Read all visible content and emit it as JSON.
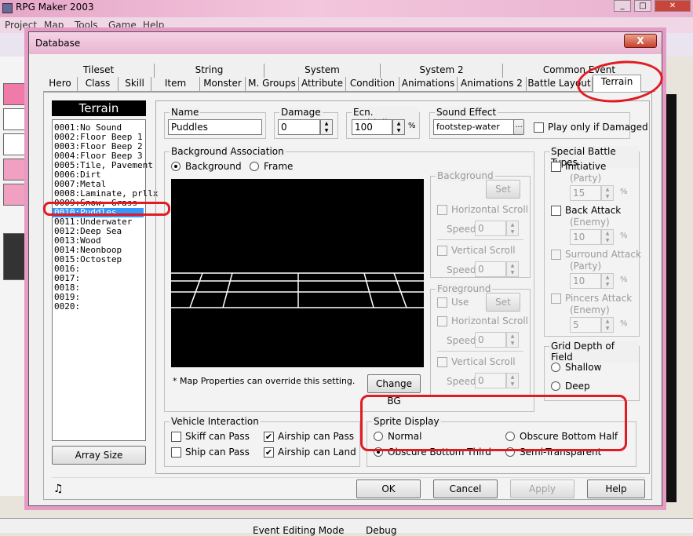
{
  "app": {
    "title": "RPG Maker 2003"
  },
  "menu": [
    "Project",
    "Map",
    "Tools",
    "Game",
    "Help"
  ],
  "dialog": {
    "title": "Database",
    "close": "X"
  },
  "tabs_row1": [
    "Tileset",
    "String",
    "System",
    "System 2",
    "Common Event"
  ],
  "tabs_row2": [
    "Hero",
    "Class",
    "Skill",
    "Item",
    "Monster",
    "M. Groups",
    "Attribute",
    "Condition",
    "Animations",
    "Animations 2",
    "Battle Layout",
    "Terrain"
  ],
  "list": {
    "header": "Terrain",
    "items": [
      "0001:No Sound",
      "0002:Floor Beep 1",
      "0003:Floor Beep 2",
      "0004:Floor Beep 3",
      "0005:Tile, Pavement",
      "0006:Dirt",
      "0007:Metal",
      "0008:Laminate, prllx",
      "0009:Snow, Grass",
      "0010:Puddles",
      "0011:Underwater",
      "0012:Deep Sea",
      "0013:Wood",
      "0014:Neonboop",
      "0015:Octostep",
      "0016:",
      "0017:",
      "0018:",
      "0019:",
      "0020:"
    ],
    "selected_index": 9,
    "array_size": "Array Size"
  },
  "name": {
    "label": "Name",
    "value": "Puddles"
  },
  "damage": {
    "label": "Damage",
    "value": "0"
  },
  "encounter": {
    "label": "Ecn. Multiplier",
    "value": "100",
    "unit": "%"
  },
  "sound": {
    "label": "Sound Effect",
    "value": "footstep-water",
    "browse": "...",
    "play_damaged": "Play only if Damaged"
  },
  "bg_assoc": {
    "label": "Background Association",
    "background": "Background",
    "frame": "Frame",
    "note": "* Map Properties can override this setting.",
    "change_bg": "Change BG",
    "bg_group": "Background",
    "fg_group": "Foreground",
    "set": "Set",
    "hscroll": "Horizontal Scroll",
    "vscroll": "Vertical Scroll",
    "speed": "Speed",
    "speed_val": "0",
    "use": "Use"
  },
  "special": {
    "label": "Special Battle Types",
    "initiative": "Initiative",
    "initiative_sub": "(Party)",
    "initiative_val": "15",
    "back": "Back Attack",
    "back_sub": "(Enemy)",
    "back_val": "10",
    "surround": "Surround Attack",
    "surround_sub": "(Party)",
    "surround_val": "10",
    "pincers": "Pincers Attack",
    "pincers_sub": "(Enemy)",
    "pincers_val": "5",
    "pct": "%"
  },
  "grid": {
    "label": "Grid Depth of Field",
    "shallow": "Shallow",
    "deep": "Deep"
  },
  "vehicle": {
    "label": "Vehicle Interaction",
    "skiff": "Skiff can Pass",
    "ship": "Ship can Pass",
    "airship_pass": "Airship can Pass",
    "airship_land": "Airship can Land"
  },
  "sprite": {
    "label": "Sprite Display",
    "normal": "Normal",
    "third": "Obscure Bottom Third",
    "half": "Obscure Bottom Half",
    "semi": "Semi-Transparent"
  },
  "buttons": {
    "ok": "OK",
    "cancel": "Cancel",
    "apply": "Apply",
    "help": "Help"
  },
  "status": {
    "left": "Event Editing Mode",
    "right": "Debug"
  },
  "colors": {
    "accent": "#e01b24",
    "selection": "#3399ff"
  }
}
